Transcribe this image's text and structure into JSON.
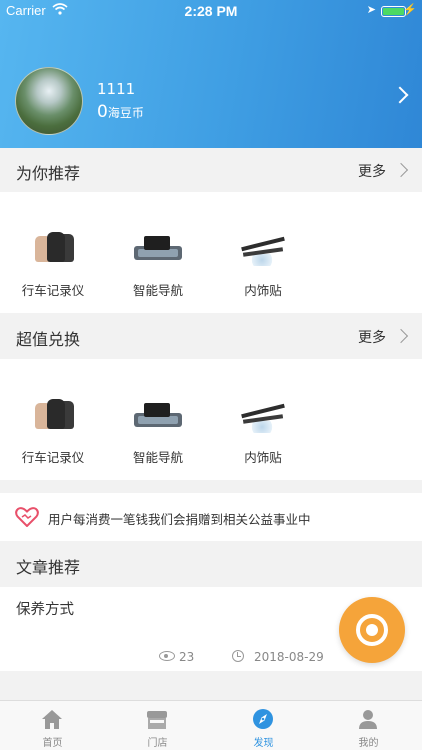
{
  "status_bar": {
    "carrier": "Carrier",
    "time": "2:28 PM"
  },
  "profile": {
    "username": "1111",
    "coin_value": "0",
    "coin_label": "海豆币"
  },
  "sections": {
    "recommend": {
      "title": "为你推荐",
      "more": "更多"
    },
    "exchange": {
      "title": "超值兑换",
      "more": "更多"
    },
    "articles": {
      "title": "文章推荐"
    }
  },
  "recommend_products": [
    {
      "label": "行车记录仪",
      "icon": "car-seat-cover-icon"
    },
    {
      "label": "智能导航",
      "icon": "mirror-navigation-icon"
    },
    {
      "label": "内饰贴",
      "icon": "wiper-blade-icon"
    }
  ],
  "exchange_products": [
    {
      "label": "行车记录仪",
      "icon": "car-seat-cover-icon"
    },
    {
      "label": "智能导航",
      "icon": "mirror-navigation-icon"
    },
    {
      "label": "内饰贴",
      "icon": "wiper-blade-icon"
    }
  ],
  "charity": {
    "text": "用户每消费一笔钱我们会捐赠到相关公益事业中",
    "icon": "heart-icon"
  },
  "article": {
    "title": "保养方式",
    "views": "23",
    "date": "2018-08-29"
  },
  "tabs": [
    {
      "label": "首页",
      "icon": "home-icon"
    },
    {
      "label": "门店",
      "icon": "store-icon"
    },
    {
      "label": "发现",
      "icon": "compass-icon",
      "active": true
    },
    {
      "label": "我的",
      "icon": "user-icon"
    }
  ],
  "colors": {
    "header_gradient_start": "#56b6f0",
    "header_gradient_end": "#2f87d6",
    "active_tab": "#2f93e0",
    "fab": "#f5a43a",
    "heart": "#e8506a"
  }
}
